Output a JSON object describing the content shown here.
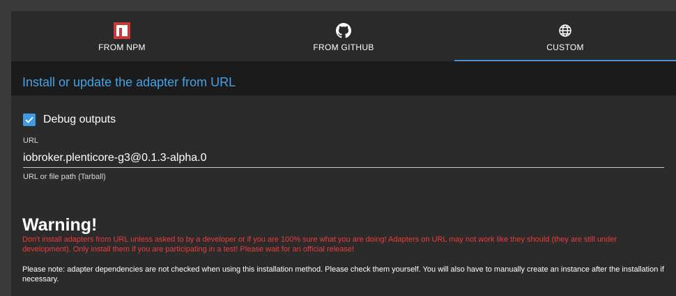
{
  "tabs": [
    {
      "label": "FROM NPM",
      "icon": "npm-icon",
      "active": false
    },
    {
      "label": "FROM GITHUB",
      "icon": "github-icon",
      "active": false
    },
    {
      "label": "CUSTOM",
      "icon": "globe-icon",
      "active": true
    }
  ],
  "section": {
    "title": "Install or update the adapter from URL"
  },
  "debug": {
    "label": "Debug outputs",
    "checked": true
  },
  "url": {
    "label": "URL",
    "value": "iobroker.plenticore-g3@0.1.3-alpha.0",
    "helper": "URL or file path (Tarball)"
  },
  "warning": {
    "title": "Warning!",
    "text": "Don't install adapters from URL unless asked to by a developer or if you are 100% sure what you are doing! Adapters on URL may not work like they should (they are still under development). Only install them if you are participating in a test! Please wait for an official release!"
  },
  "note": {
    "text": "Please note: adapter dependencies are not checked when using this installation method. Please check them yourself. You will also have to manually create an instance after the installation if necessary."
  },
  "colors": {
    "accent": "#44a3e6",
    "warning": "#f03a3a",
    "checkbox": "#3f9ae6",
    "background": "#2b2b2b"
  }
}
